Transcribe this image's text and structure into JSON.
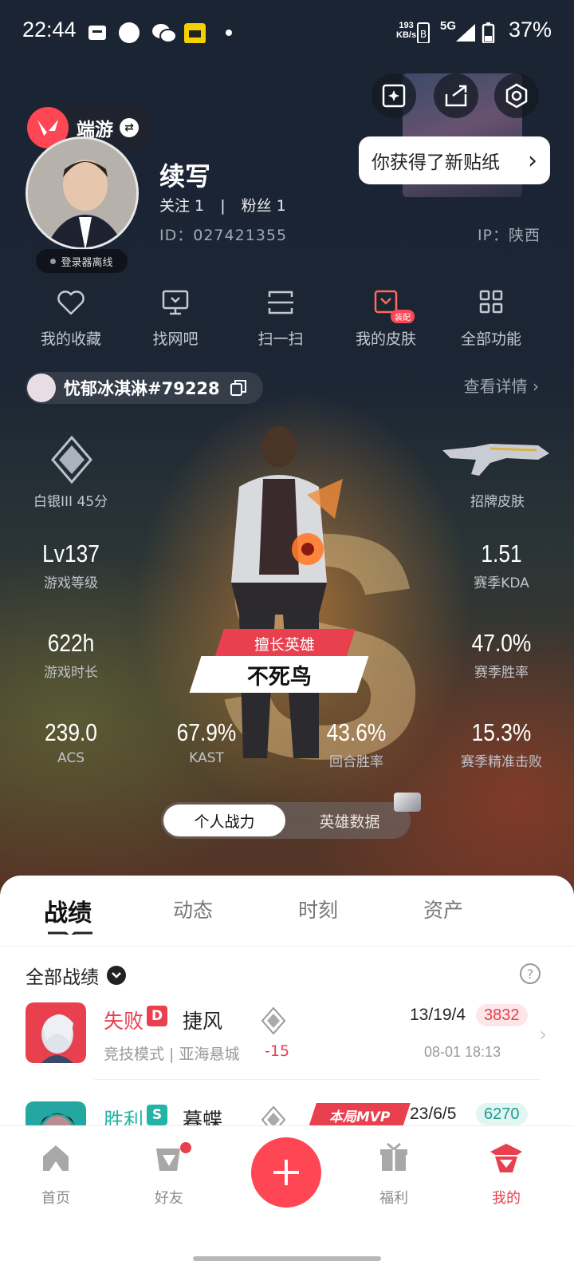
{
  "status_bar": {
    "time": "22:44",
    "net_speed": "193",
    "net_unit": "KB/s",
    "network": "5G",
    "battery": "37%"
  },
  "profile": {
    "game_name": "端游",
    "nickname": "续写",
    "follow_label": "关注 1",
    "sep": "|",
    "fans_label": "粉丝 1",
    "user_id": "ID：027421355",
    "ip": "IP：陕西",
    "online_status": "登录器离线",
    "sticker_tip": "你获得了新贴纸",
    "sticker_chevron": "›"
  },
  "functions": [
    {
      "label": "我的收藏",
      "icon": "heart-icon"
    },
    {
      "label": "找网吧",
      "icon": "monitor-icon"
    },
    {
      "label": "扫一扫",
      "icon": "scan-icon"
    },
    {
      "label": "我的皮肤",
      "icon": "skin-icon",
      "badge": "装配"
    },
    {
      "label": "全部功能",
      "icon": "grid-icon"
    }
  ],
  "riot": {
    "name": "忧郁冰淇淋#79228",
    "detail_link": "查看详情 ›"
  },
  "rank": {
    "text": "白银III 45分",
    "skin_label": "招牌皮肤"
  },
  "stats": {
    "level": {
      "value": "Lv137",
      "label": "游戏等级"
    },
    "kda": {
      "value": "1.51",
      "label": "赛季KDA"
    },
    "hours": {
      "value": "622h",
      "label": "游戏时长"
    },
    "win_rate": {
      "value": "47.0%",
      "label": "赛季胜率"
    },
    "acs": {
      "value": "239.0",
      "label": "ACS"
    },
    "kast": {
      "value": "67.9%",
      "label": "KAST"
    },
    "round_win": {
      "value": "43.6%",
      "label": "回合胜率"
    },
    "headshot": {
      "value": "15.3%",
      "label": "赛季精准击败"
    }
  },
  "main_hero": {
    "tag": "擅长英雄",
    "name": "不死鸟"
  },
  "toggle": {
    "active": "个人战力",
    "inactive": "英雄数据"
  },
  "tabs": [
    "战绩",
    "动态",
    "时刻",
    "资产"
  ],
  "filter_label": "全部战绩",
  "help_label": "?",
  "matches": [
    {
      "result": "失败",
      "result_color": "#e8404f",
      "mode_letter": "D",
      "mode_color": "#e8404f",
      "agent": "捷风",
      "sub": "竞技模式 | 亚海悬城",
      "delta": "-15",
      "kda": "13/19/4",
      "score": "3832",
      "score_color": "#e8404f",
      "score_bg": "#fde6e8",
      "time": "08-01 18:13",
      "arrow": "›"
    },
    {
      "result": "胜利",
      "result_color": "#23b4a6",
      "mode_letter": "S",
      "mode_color": "#23b4a6",
      "agent": "暮蝶",
      "mvp": "本局MVP",
      "kda": "23/6/5",
      "score": "6270",
      "score_color": "#1f9c8f",
      "score_bg": "#e1f6f2",
      "arrow": "›"
    }
  ],
  "navbar": [
    {
      "label": "首页",
      "icon": "home-icon"
    },
    {
      "label": "好友",
      "icon": "friends-icon"
    },
    {
      "label": "福利",
      "icon": "gift-icon"
    },
    {
      "label": "我的",
      "icon": "profile-icon",
      "active": true
    }
  ],
  "colors": {
    "accent": "#ff4655",
    "win": "#23b4a6",
    "loss": "#e8404f"
  }
}
